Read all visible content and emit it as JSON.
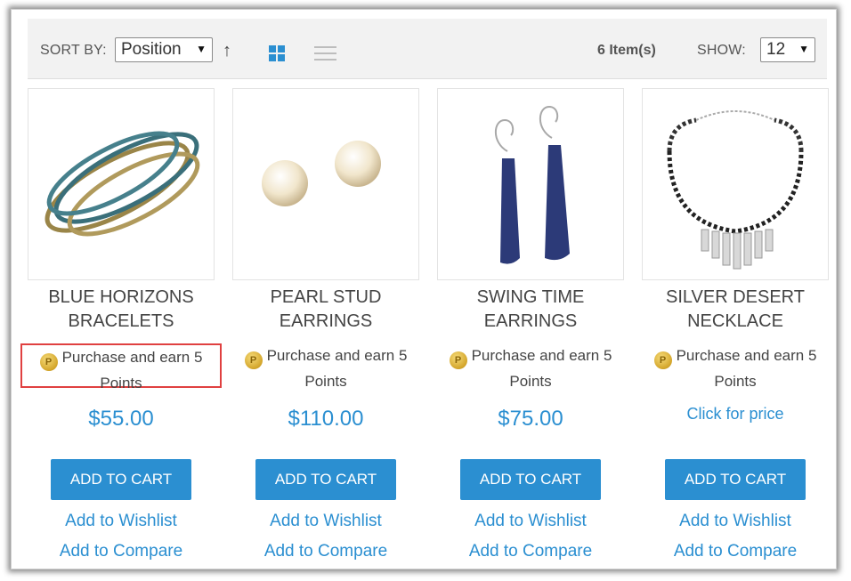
{
  "toolbar": {
    "sort_label": "SORT BY:",
    "sort_value": "Position",
    "item_count": "6 Item(s)",
    "show_label": "SHOW:",
    "show_value": "12"
  },
  "products": [
    {
      "name_line1": "BLUE HORIZONS",
      "name_line2": "BRACELETS",
      "points_line1": "Purchase and earn 5",
      "points_line2": "Points",
      "price": "$55.00",
      "cart": "ADD TO CART",
      "wishlist": "Add to Wishlist",
      "compare": "Add to Compare"
    },
    {
      "name_line1": "PEARL STUD",
      "name_line2": "EARRINGS",
      "points_line1": "Purchase and earn 5",
      "points_line2": "Points",
      "price": "$110.00",
      "cart": "ADD TO CART",
      "wishlist": "Add to Wishlist",
      "compare": "Add to Compare"
    },
    {
      "name_line1": "SWING TIME",
      "name_line2": "EARRINGS",
      "points_line1": "Purchase and earn 5",
      "points_line2": "Points",
      "price": "$75.00",
      "cart": "ADD TO CART",
      "wishlist": "Add to Wishlist",
      "compare": "Add to Compare"
    },
    {
      "name_line1": "SILVER DESERT",
      "name_line2": "NECKLACE",
      "points_line1": "Purchase and earn 5",
      "points_line2": "Points",
      "price": "Click for price",
      "cart": "ADD TO CART",
      "wishlist": "Add to Wishlist",
      "compare": "Add to Compare"
    }
  ],
  "colors": {
    "accent": "#2b8fd1",
    "highlight": "#e04040",
    "text": "#444444"
  }
}
